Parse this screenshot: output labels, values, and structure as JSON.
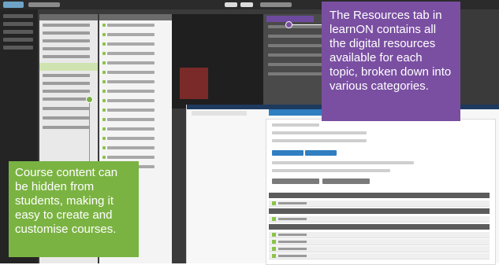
{
  "callouts": {
    "resources": "The Resources tab in learnON contains all the digital resources available for each topic, broken down into various categories.",
    "course_content": "Course content can be hidden from students, making it easy to create and customise courses."
  },
  "colors": {
    "purple_callout": "#7a4fa2",
    "green_callout": "#7bb342"
  }
}
